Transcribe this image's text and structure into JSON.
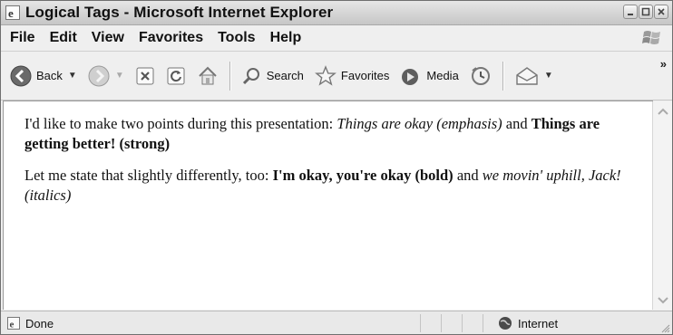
{
  "window": {
    "title": "Logical Tags - Microsoft Internet Explorer",
    "icon": "ie-icon",
    "controls": [
      "minimize-icon",
      "maximize-icon",
      "close-icon"
    ]
  },
  "menubar": {
    "items": [
      "File",
      "Edit",
      "View",
      "Favorites",
      "Tools",
      "Help"
    ]
  },
  "toolbar": {
    "back_label": "Back",
    "search_label": "Search",
    "favorites_label": "Favorites",
    "media_label": "Media",
    "more": "»"
  },
  "content": {
    "p1_text": "I'd like to make two points during this presentation: ",
    "p1_em": "Things are okay (emphasis)",
    "p1_and": " and ",
    "p1_strong": "Things are getting better! (strong)",
    "p2_text": "Let me state that slightly differently, too: ",
    "p2_bold": "I'm okay, you're okay (bold)",
    "p2_and": " and ",
    "p2_italics": "we movin' uphill, Jack! (italics)"
  },
  "status": {
    "text": "Done",
    "zone": "Internet"
  }
}
